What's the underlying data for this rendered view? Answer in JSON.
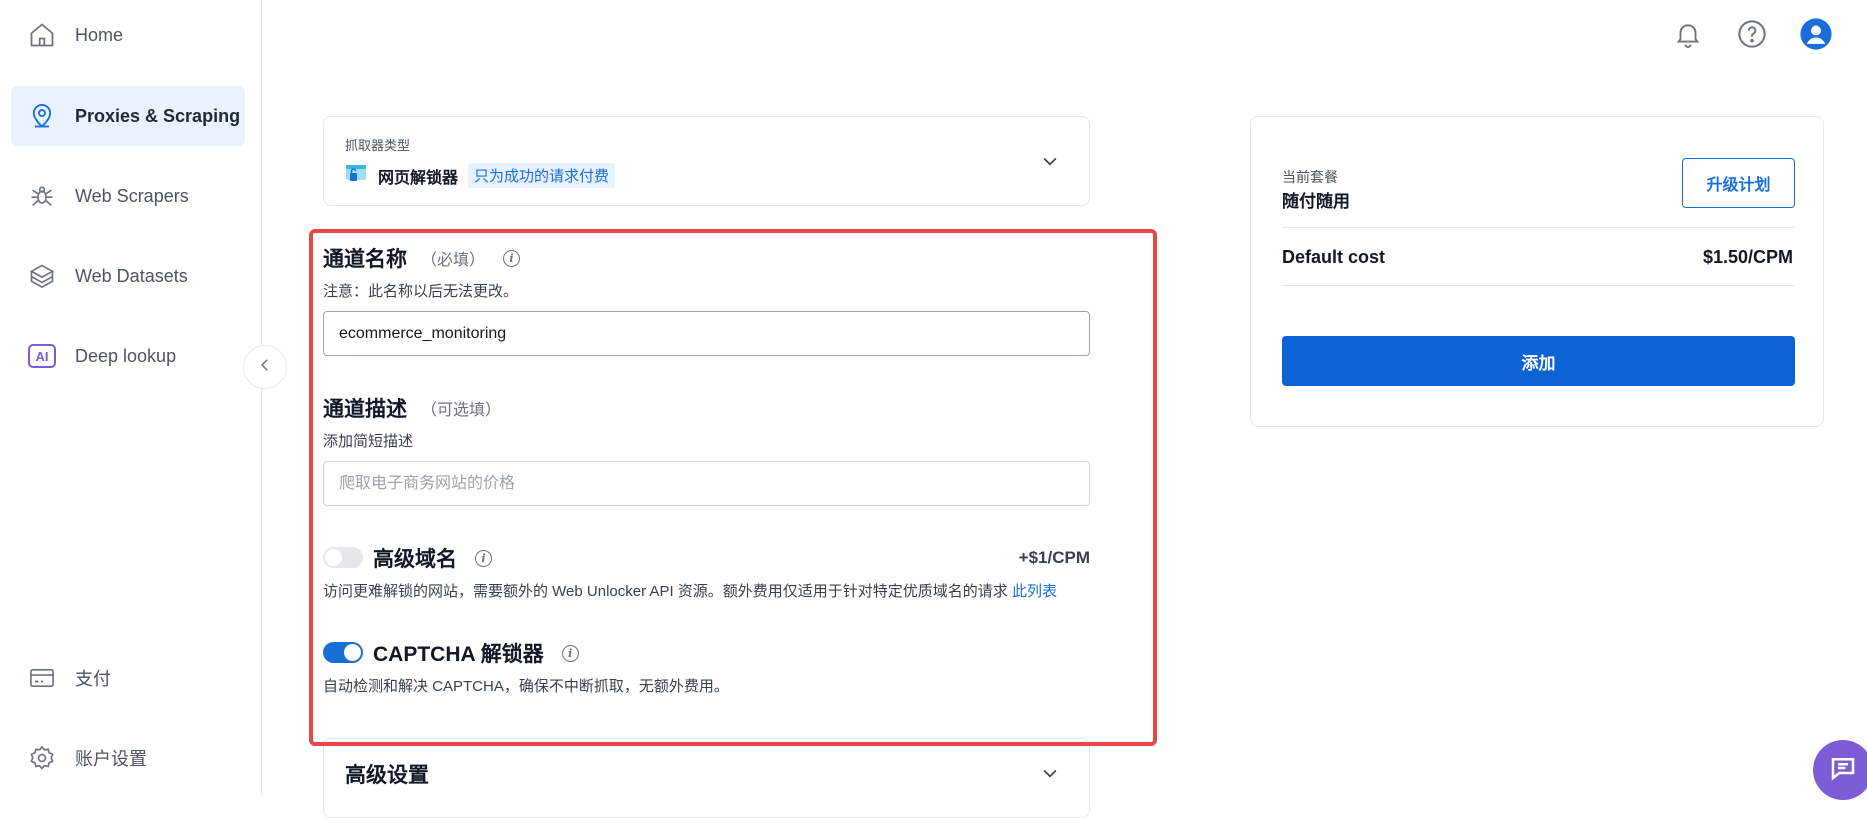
{
  "sidebar": {
    "items": [
      {
        "label": "Home",
        "icon": "home-icon"
      },
      {
        "label": "Proxies & Scraping",
        "icon": "location-pin-icon",
        "active": true
      },
      {
        "label": "Web Scrapers",
        "icon": "spider-icon"
      },
      {
        "label": "Web Datasets",
        "icon": "layers-icon"
      },
      {
        "label": "Deep lookup",
        "icon": "ai-badge-icon",
        "badge": "AI"
      }
    ],
    "bottom_items": [
      {
        "label": "支付",
        "icon": "credit-card-icon"
      },
      {
        "label": "账户设置",
        "icon": "gear-icon"
      }
    ]
  },
  "header": {
    "icons": [
      "bell-icon",
      "help-icon",
      "user-avatar-icon"
    ]
  },
  "scraper_type": {
    "label": "抓取器类型",
    "name": "网页解锁器",
    "tag": "只为成功的请求付费"
  },
  "channel_name": {
    "title": "通道名称",
    "hint": "（必填）",
    "note": "注意：此名称以后无法更改。",
    "value": "ecommerce_monitoring"
  },
  "channel_desc": {
    "title": "通道描述",
    "hint": "（可选填）",
    "note": "添加简短描述",
    "placeholder": "爬取电子商务网站的价格"
  },
  "premium_domains": {
    "title": "高级域名",
    "price": "+$1/CPM",
    "description": "访问更难解锁的网站，需要额外的 Web Unlocker API 资源。额外费用仅适用于针对特定优质域名的请求",
    "link": "此列表",
    "enabled": false
  },
  "captcha": {
    "title": "CAPTCHA 解锁器",
    "description": "自动检测和解决 CAPTCHA，确保不中断抓取，无额外费用。",
    "enabled": true
  },
  "advanced": {
    "title": "高级设置"
  },
  "plan": {
    "label": "当前套餐",
    "name": "随付随用",
    "upgrade_label": "升级计划",
    "cost_label": "Default cost",
    "cost_value": "$1.50/CPM",
    "add_label": "添加"
  },
  "colors": {
    "accent": "#1a6fd6",
    "highlight": "#e64848",
    "chat": "#7c5cd6"
  }
}
